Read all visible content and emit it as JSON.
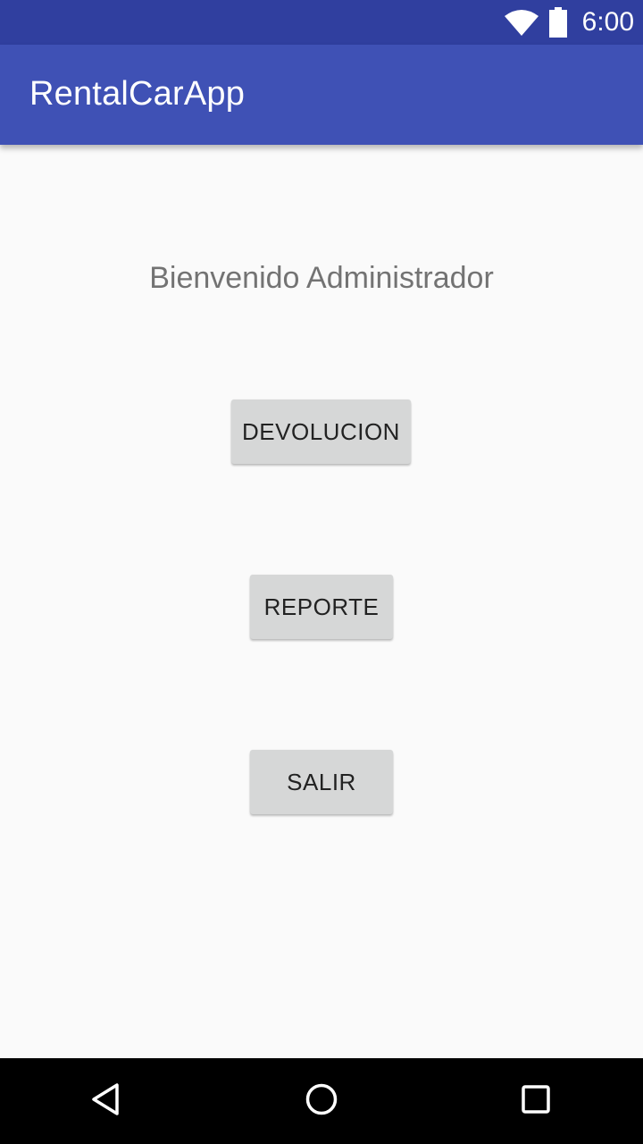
{
  "status_bar": {
    "time": "6:00",
    "icons": [
      "wifi-icon",
      "battery-icon"
    ],
    "background": "#303f9f"
  },
  "app_bar": {
    "title": "RentalCarApp",
    "background": "#3f51b5"
  },
  "main": {
    "welcome_text": "Bienvenido Administrador",
    "buttons": [
      {
        "label": "DEVOLUCION"
      },
      {
        "label": "REPORTE"
      },
      {
        "label": "SALIR"
      }
    ],
    "button_color": "#d6d7d7"
  },
  "nav_bar": {
    "icons": [
      "back-icon",
      "home-icon",
      "recents-icon"
    ]
  }
}
